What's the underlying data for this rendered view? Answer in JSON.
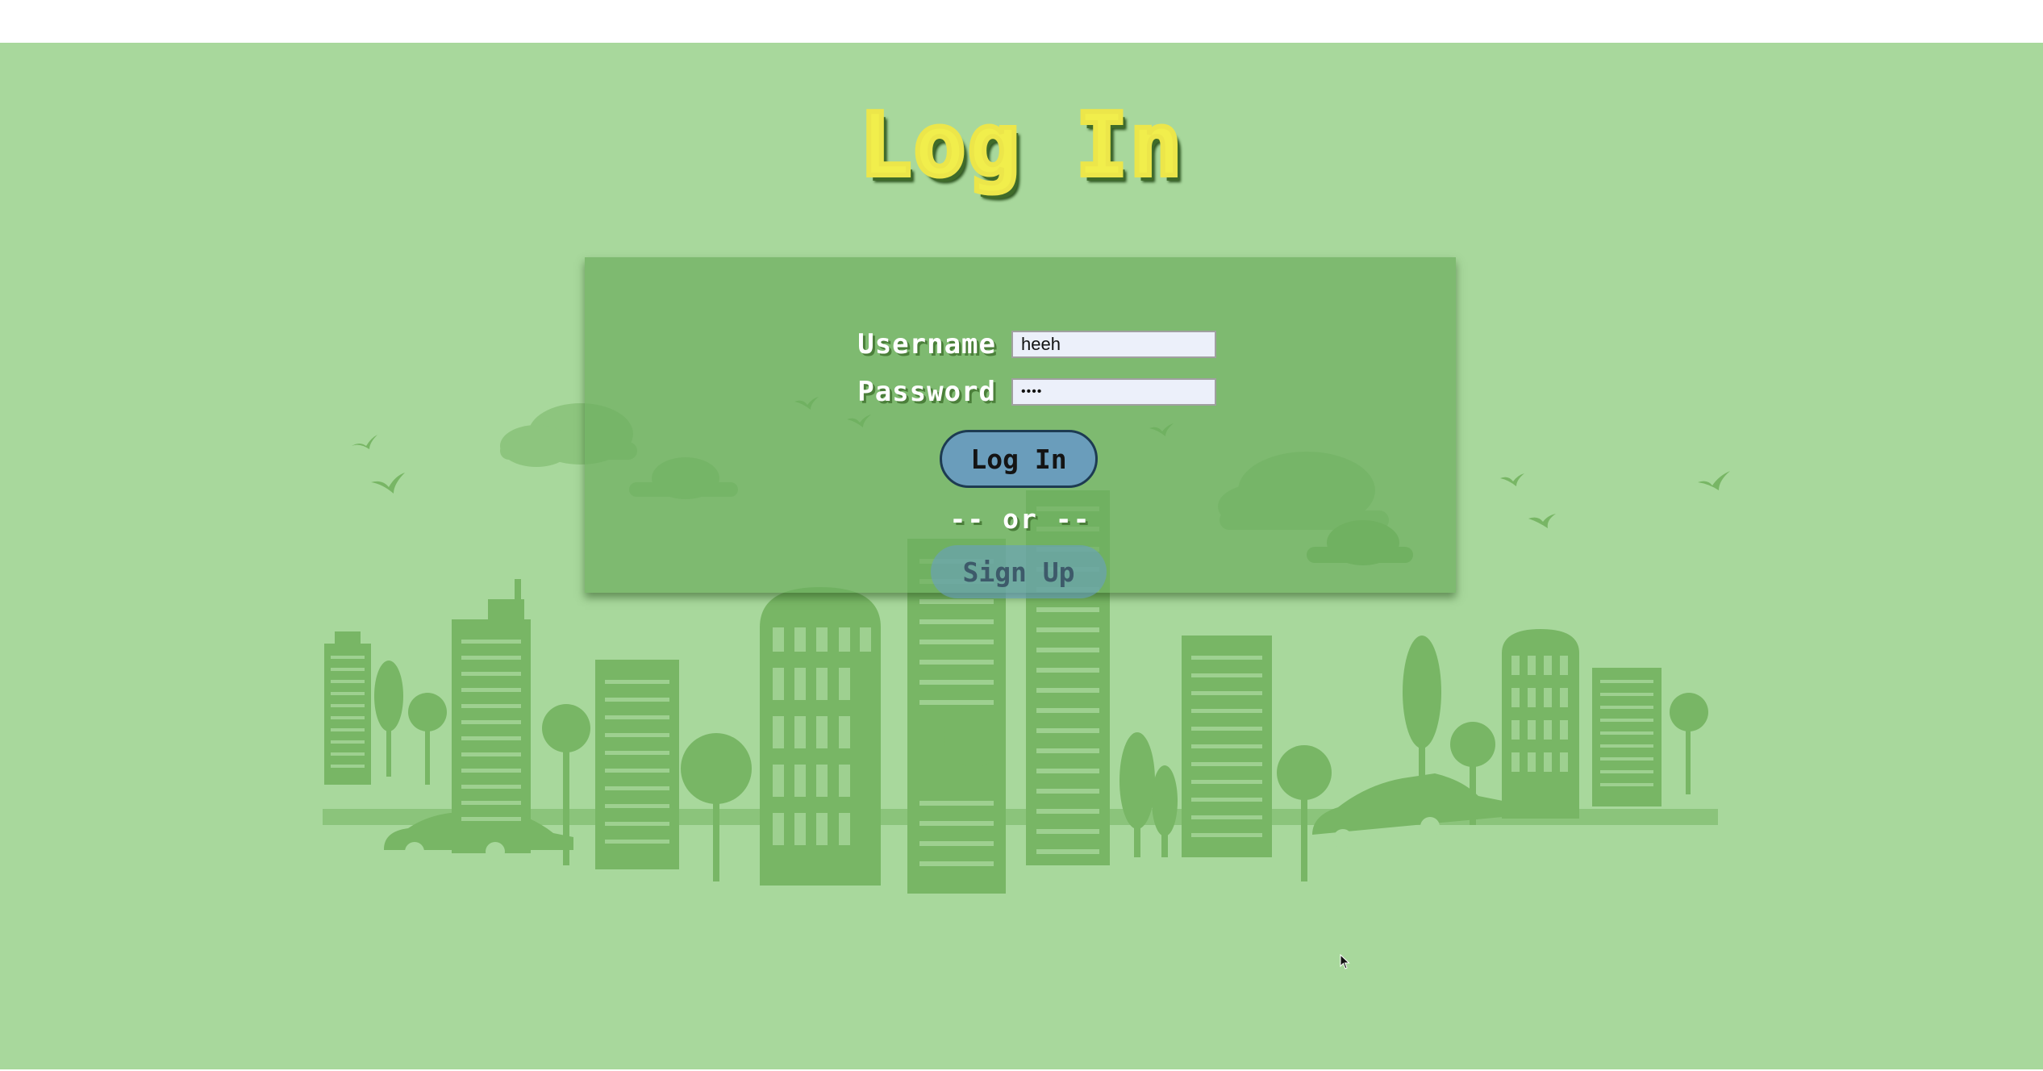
{
  "title": "Log In",
  "form": {
    "username_label": "Username",
    "username_value": "heeh",
    "password_label": "Password",
    "password_value": "••••",
    "login_label": "Log In",
    "or_text": "-- or --",
    "signup_label": "Sign Up"
  },
  "colors": {
    "background": "#a8d89c",
    "skyline": "#6fb05b",
    "title": "#f1ee4c",
    "login_button": "#6a9dbb",
    "panel": "#7fbb6f"
  }
}
